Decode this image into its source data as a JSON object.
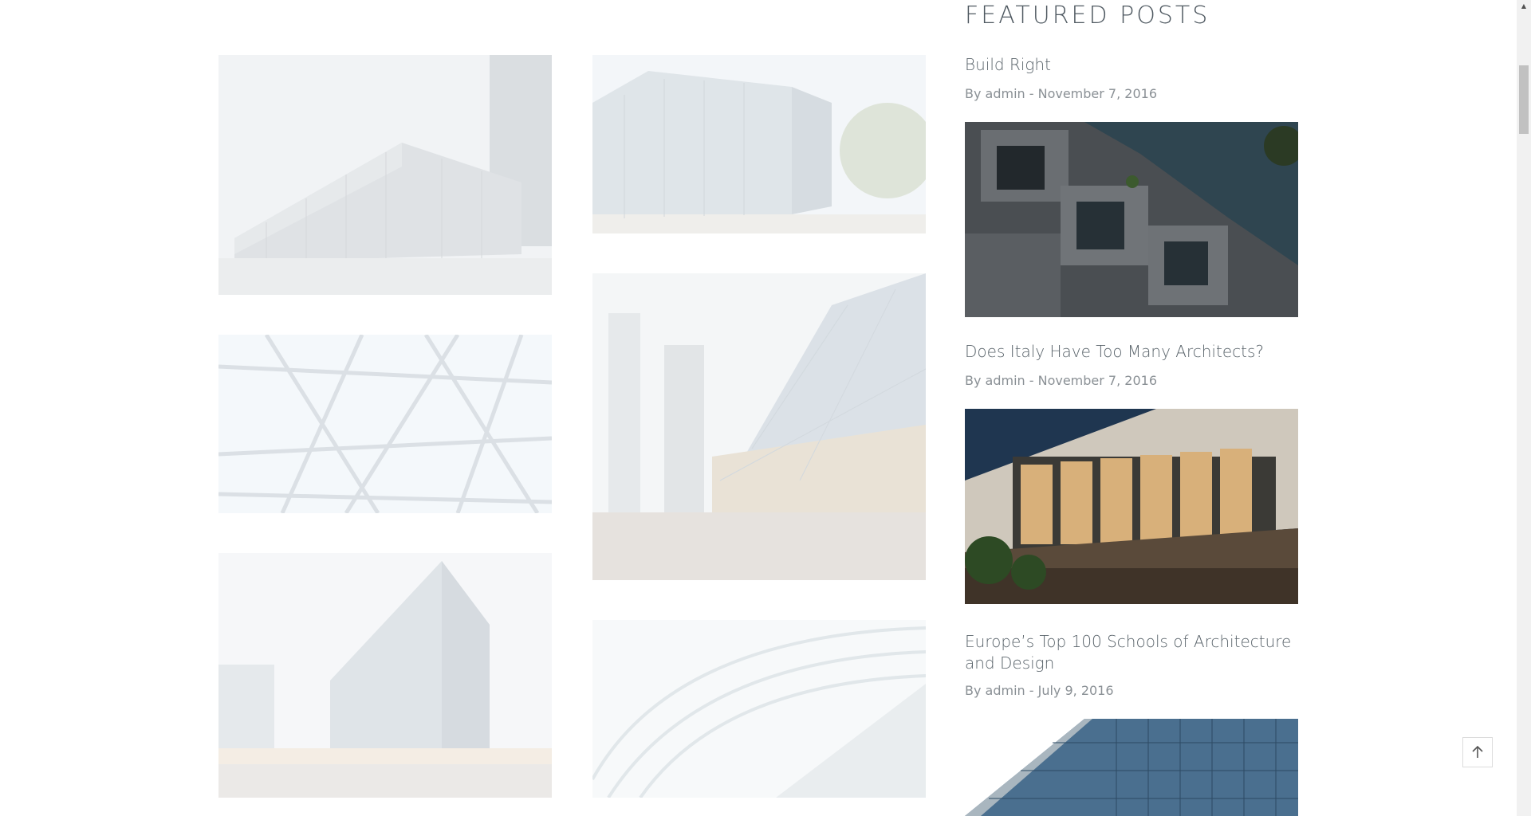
{
  "featured": {
    "title": "FEATURED POSTS",
    "posts": [
      {
        "title": "Build Right",
        "meta": "By admin - November 7, 2016",
        "image_icon": "apartment-photo"
      },
      {
        "title": "Does Italy Have Too Many Architects?",
        "meta": "By admin - November 7, 2016",
        "image_icon": "villa-photo"
      },
      {
        "title": "Europe’s Top 100 Schools of Architecture and Design",
        "meta": "By admin - July 9, 2016",
        "image_icon": "glass-facade-photo"
      }
    ]
  },
  "gallery": {
    "images": [
      "office-building-photo",
      "glass-offices-photo",
      "glass-dome-photo",
      "skyline-glass-photo",
      "glass-cube-building-photo",
      "tunnel-walkway-photo"
    ]
  },
  "colors": {
    "heading": "#4f5961",
    "meta": "#8a9095",
    "sky_dark": "#2f4550"
  }
}
